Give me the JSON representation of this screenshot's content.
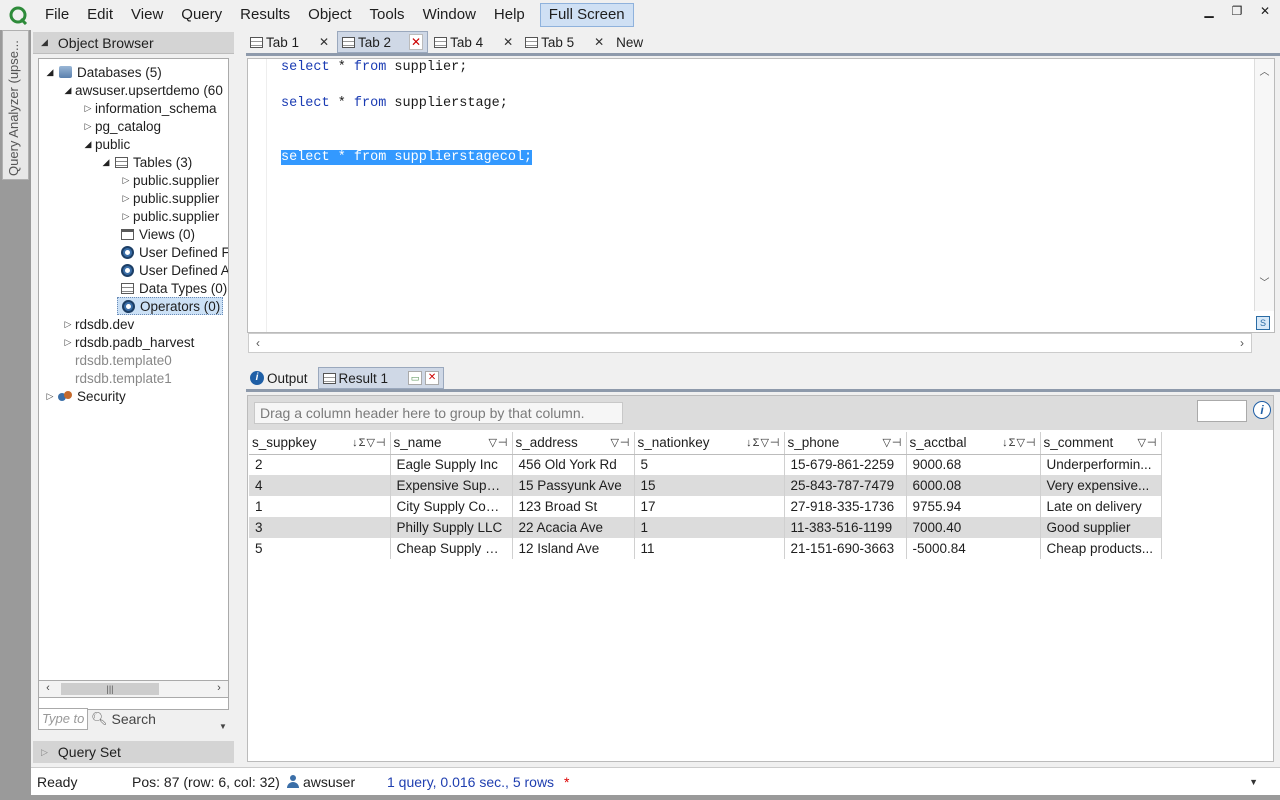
{
  "menubar": {
    "items": [
      "File",
      "Edit",
      "View",
      "Query",
      "Results",
      "Object",
      "Tools",
      "Window",
      "Help"
    ],
    "fullscreen_label": "Full Screen"
  },
  "side_tab": {
    "label": "Query Analyzer (upse..."
  },
  "object_browser": {
    "title": "Object Browser",
    "tree": {
      "databases": "Databases (5)",
      "db_main": "awsuser.upsertdemo (60",
      "information_schema": "information_schema",
      "pg_catalog": "pg_catalog",
      "public": "public",
      "tables": "Tables (3)",
      "table1": "public.supplier",
      "table2": "public.supplier",
      "table3": "public.supplier",
      "views": "Views (0)",
      "udf1": "User Defined F",
      "udf2": "User Defined A",
      "data_types": "Data Types (0)",
      "operators": "Operators (0)",
      "rdsdb_dev": "rdsdb.dev",
      "rdsdb_padb": "rdsdb.padb_harvest",
      "template0": "rdsdb.template0",
      "template1": "rdsdb.template1",
      "security": "Security"
    },
    "type_placeholder": "Type to",
    "search_label": "Search",
    "query_set_label": "Query Set"
  },
  "editor_tabs": [
    {
      "label": "Tab 1"
    },
    {
      "label": "Tab 2"
    },
    {
      "label": "Tab 4"
    },
    {
      "label": "Tab 5"
    },
    {
      "label": "New"
    }
  ],
  "sql": {
    "line1": {
      "kw1": "select",
      "rest1": " * ",
      "kw2": "from",
      "rest2": " supplier;"
    },
    "line2": {
      "kw1": "select",
      "rest1": " * ",
      "kw2": "from",
      "rest2": " supplierstage;"
    },
    "line3": {
      "kw1": "select",
      "rest1": " * ",
      "kw2": "from",
      "rest2": " supplierstagecol;"
    }
  },
  "result_tabs": {
    "output": "Output",
    "result1": "Result 1"
  },
  "grid": {
    "group_hint": "Drag a column header here to group by that column.",
    "columns": [
      "s_suppkey",
      "s_name",
      "s_address",
      "s_nationkey",
      "s_phone",
      "s_acctbal",
      "s_comment"
    ],
    "rows": [
      [
        "2",
        "Eagle Supply Inc",
        "456 Old York Rd",
        "5",
        "15-679-861-2259",
        "9000.68",
        " Underperformin..."
      ],
      [
        "4",
        "Expensive Suppl...",
        "15 Passyunk Ave",
        "15",
        "25-843-787-7479",
        "6000.08",
        "Very expensive..."
      ],
      [
        "1",
        "City Supply Com...",
        "123 Broad St",
        "17",
        "27-918-335-1736",
        "9755.94",
        "Late on delivery"
      ],
      [
        "3",
        "Philly Supply LLC",
        "22 Acacia Ave",
        "1",
        "11-383-516-1199",
        "7000.40",
        "Good supplier"
      ],
      [
        "5",
        "Cheap Supply C...",
        "12 Island Ave",
        "11",
        "21-151-690-3663",
        "-5000.84",
        "Cheap products..."
      ]
    ]
  },
  "status": {
    "ready": "Ready",
    "pos": "Pos: 87 (row: 6, col: 32)",
    "user": "awsuser",
    "query": "1 query, 0.016 sec., 5 rows",
    "star": "*"
  }
}
